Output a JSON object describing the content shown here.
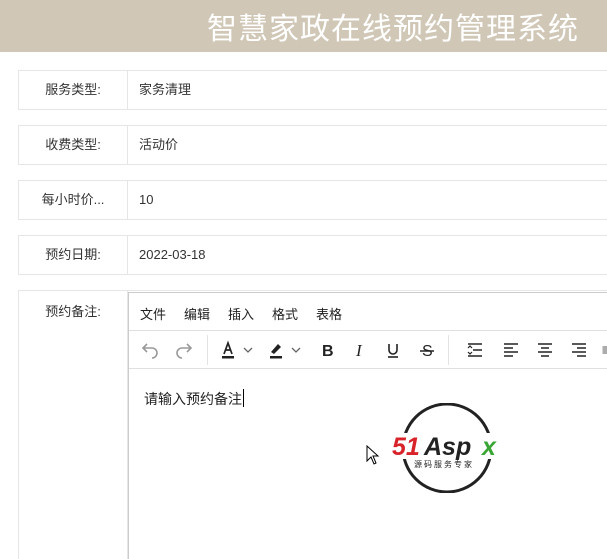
{
  "header": {
    "title": "智慧家政在线预约管理系统"
  },
  "form": {
    "service_type": {
      "label": "服务类型:",
      "value": "家务清理"
    },
    "fee_type": {
      "label": "收费类型:",
      "value": "活动价"
    },
    "hourly_price": {
      "label": "每小时价...",
      "value": "10"
    },
    "appointment_date": {
      "label": "预约日期:",
      "value": "2022-03-18"
    },
    "appointment_note": {
      "label": "预约备注:"
    }
  },
  "editor": {
    "menus": [
      "文件",
      "编辑",
      "插入",
      "格式",
      "表格"
    ],
    "content": "请输入预约备注",
    "toolbar_icons": [
      "undo-icon",
      "redo-icon",
      "font-color-icon",
      "highlight-color-icon",
      "bold-icon",
      "italic-icon",
      "underline-icon",
      "strikethrough-icon",
      "line-height-icon",
      "align-left-icon",
      "align-center-icon",
      "align-right-icon"
    ]
  },
  "watermark": {
    "brand": "51Aspx",
    "tagline": "源码服务专家",
    "colors": {
      "red": "#d8232a",
      "green": "#3aa635",
      "dark": "#222222"
    }
  }
}
